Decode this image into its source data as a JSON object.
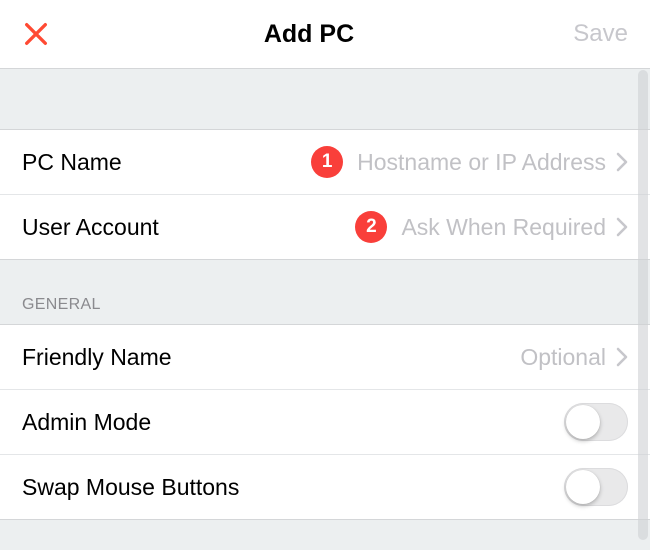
{
  "header": {
    "title": "Add PC",
    "save_label": "Save"
  },
  "callouts": {
    "pc_name": "1",
    "user_account": "2"
  },
  "rows": {
    "pc_name": {
      "label": "PC Name",
      "value": "Hostname or IP Address"
    },
    "user_account": {
      "label": "User Account",
      "value": "Ask When Required"
    },
    "friendly_name": {
      "label": "Friendly Name",
      "value": "Optional"
    },
    "admin_mode": {
      "label": "Admin Mode",
      "on": false
    },
    "swap_mouse": {
      "label": "Swap Mouse Buttons",
      "on": false
    }
  },
  "sections": {
    "general": "GENERAL"
  },
  "icons": {
    "close": "close-icon",
    "chevron": "chevron-right-icon"
  },
  "colors": {
    "accent_red": "#ff4a33",
    "callout_red": "#f93f3a",
    "placeholder_gray": "#c1c1c5",
    "section_text": "#8a8a8e"
  }
}
